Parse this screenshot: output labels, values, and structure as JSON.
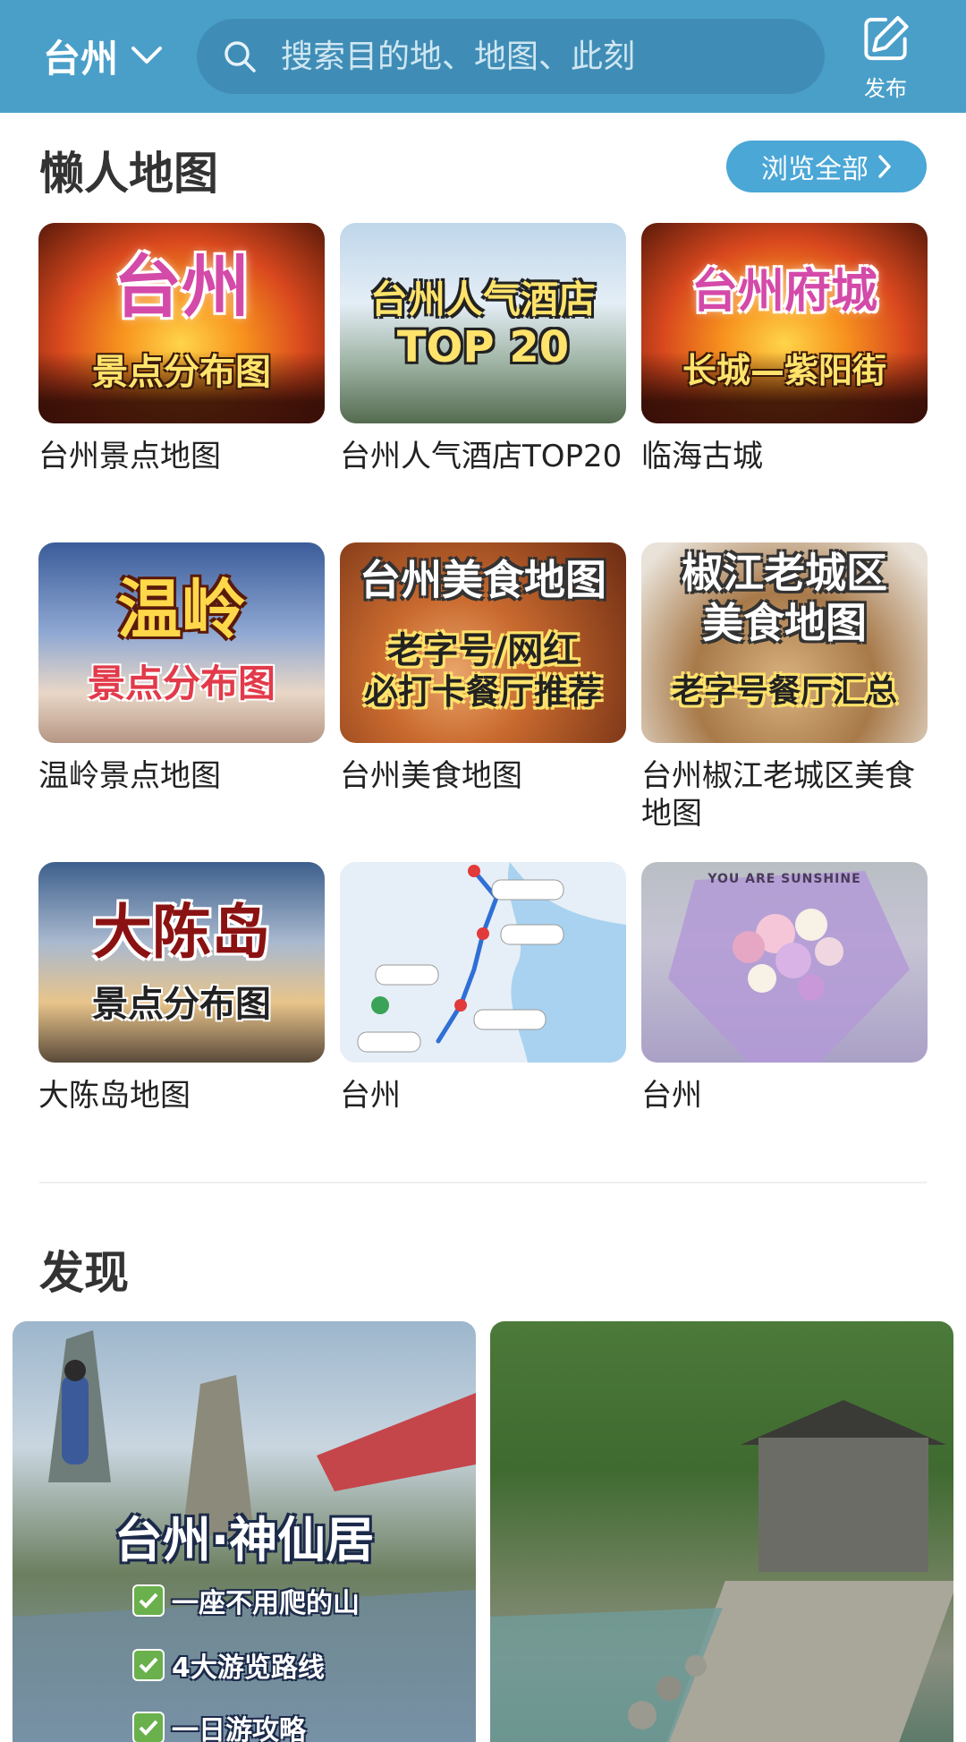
{
  "header": {
    "city": "台州",
    "search_placeholder": "搜索目的地、地图、此刻",
    "publish_label": "发布"
  },
  "lazy_maps": {
    "title": "懒人地图",
    "browse_all": "浏览全部",
    "cards": [
      {
        "caption": "台州景点地图",
        "overlay": [
          "台州",
          "景点分布图"
        ]
      },
      {
        "caption": "台州人气酒店TOP20",
        "overlay": [
          "台州人气酒店",
          "TOP 20"
        ]
      },
      {
        "caption": "临海古城",
        "overlay": [
          "台州府城",
          "长城—紫阳街"
        ]
      },
      {
        "caption": "温岭景点地图",
        "overlay": [
          "温岭",
          "景点分布图"
        ]
      },
      {
        "caption": "台州美食地图",
        "overlay": [
          "台州美食地图",
          "老字号/网红",
          "必打卡餐厅推荐"
        ]
      },
      {
        "caption": "台州椒江老城区美食地图",
        "overlay": [
          "椒江老城区",
          "美食地图",
          "老字号餐厅汇总"
        ]
      },
      {
        "caption": "大陈岛地图",
        "overlay": [
          "大陈岛",
          "景点分布图"
        ]
      },
      {
        "caption": "台州",
        "overlay": []
      },
      {
        "caption": "台州",
        "overlay": [
          "YOU ARE SUNSHINE"
        ]
      }
    ]
  },
  "discover": {
    "title": "发现",
    "posts": [
      {
        "overlay_title": "台州·神仙居",
        "checklist": [
          "一座不用爬的山",
          "4大游览路线",
          "一日游攻略"
        ]
      },
      {
        "overlay_title": ""
      }
    ]
  },
  "colors": {
    "header_bg": "#4a9fc9",
    "accent": "#4aa7d6"
  },
  "icons": {
    "city_dropdown": "chevron-down-icon",
    "search": "search-icon",
    "publish": "edit-icon",
    "browse_all": "chevron-right-icon"
  }
}
